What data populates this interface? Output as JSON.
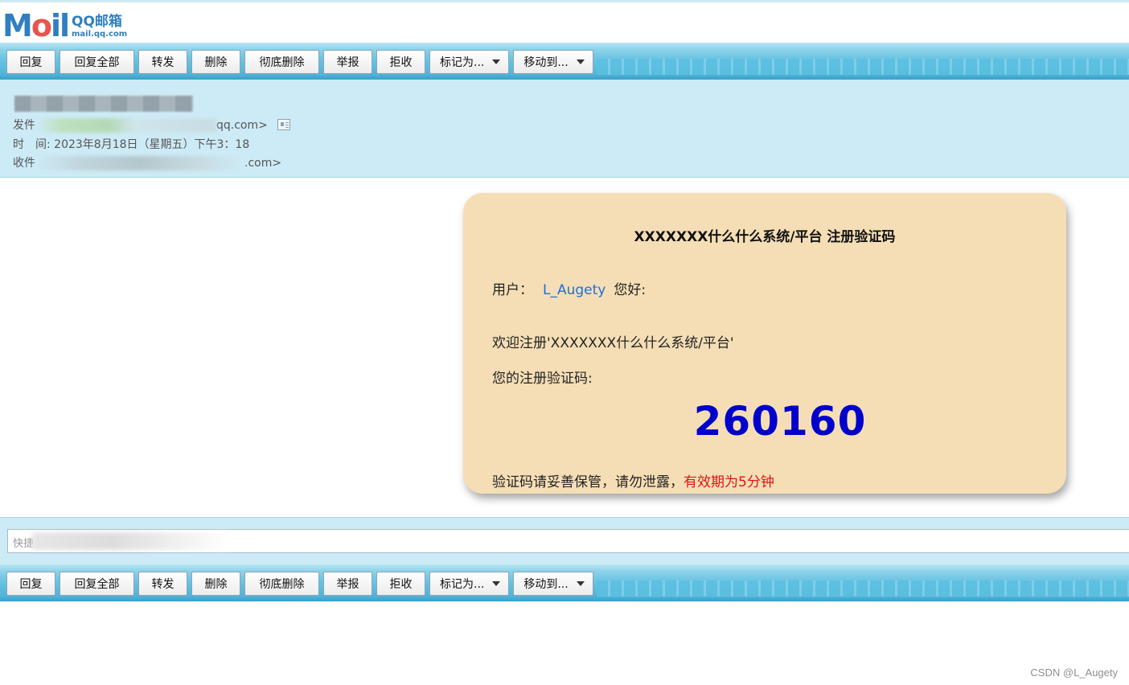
{
  "logo": {
    "mark_prefix": "M",
    "mark_o": "o",
    "mark_suffix": "il",
    "name": "QQ邮箱",
    "domain": "mail.qq.com"
  },
  "toolbar": {
    "reply": "回复",
    "reply_all": "回复全部",
    "forward": "转发",
    "delete": "删除",
    "delete_permanently": "彻底删除",
    "report": "举报",
    "reject": "拒收",
    "mark_as": "标记为...",
    "move_to": "移动到..."
  },
  "header": {
    "from_label": "发件",
    "from_suffix": "qq.com>",
    "time_label": "时　间:",
    "time_value": "2023年8月18日（星期五）下午3：18",
    "to_label": "收件",
    "to_suffix": ".com>"
  },
  "mail": {
    "title": "XXXXXXX什么什么系统/平台 注册验证码",
    "user_label": "用户：",
    "username": "L_Augety",
    "greeting": "您好:",
    "welcome": "欢迎注册'XXXXXXX什么什么系统/平台'",
    "code_label": "您的注册验证码:",
    "code": "260160",
    "notice": "验证码请妥善保管，请勿泄露，",
    "validity": "有效期为5分钟"
  },
  "quick_reply": {
    "placeholder": "快捷"
  },
  "watermark": "CSDN @L_Augety",
  "colors": {
    "toolbar_blue": "#4fb3d8",
    "header_bg": "#cdebf6",
    "card_bg": "#f5deb5",
    "code": "#0000cc",
    "username": "#1a6ee0",
    "validity": "#e01414"
  }
}
